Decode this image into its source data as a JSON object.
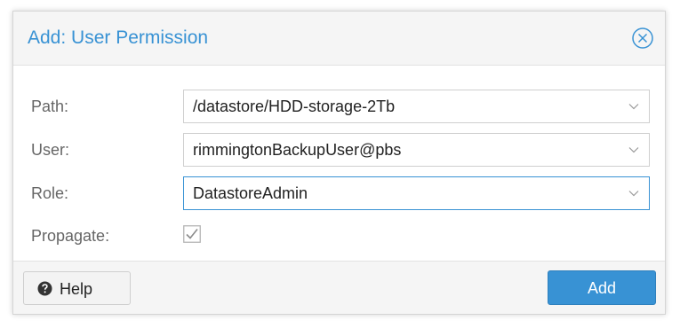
{
  "dialog": {
    "title": "Add: User Permission",
    "close_icon": "close-circle-icon"
  },
  "form": {
    "path": {
      "label": "Path:",
      "value": "/datastore/HDD-storage-2Tb"
    },
    "user": {
      "label": "User:",
      "value": "rimmingtonBackupUser@pbs"
    },
    "role": {
      "label": "Role:",
      "value": "DatastoreAdmin"
    },
    "propagate": {
      "label": "Propagate:",
      "checked": true
    }
  },
  "footer": {
    "help_label": "Help",
    "help_icon": "question-circle-icon",
    "add_label": "Add"
  },
  "colors": {
    "accent": "#3892d4",
    "label": "#666666",
    "header_bg": "#f5f5f5"
  }
}
